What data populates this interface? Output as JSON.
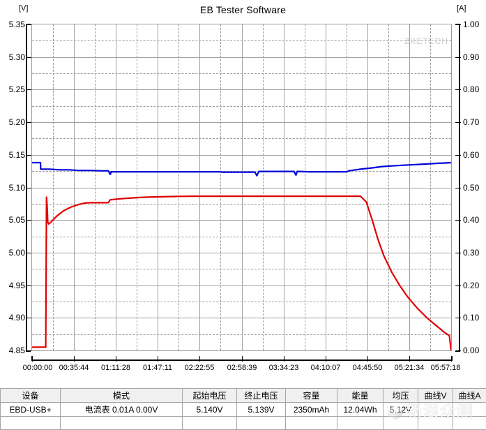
{
  "header": {
    "title": "EB Tester Software",
    "unit_left": "[V]",
    "unit_right": "[A]"
  },
  "plot": {
    "watermark": "ZKETECH"
  },
  "watermark_overlay": {
    "text": "新浪众测",
    "logo": "sina-cube-logo"
  },
  "chart_data": {
    "type": "line",
    "title": "EB Tester Software",
    "xlabel": "",
    "ylabel": "[V]",
    "ylabel_right": "[A]",
    "grid": true,
    "legend_position": "table-swatches",
    "x_ticklabels": [
      "00:00:00",
      "00:35:44",
      "01:11:28",
      "01:47:11",
      "02:22:55",
      "02:58:39",
      "03:34:23",
      "04:10:07",
      "04:45:50",
      "05:21:34",
      "05:57:18"
    ],
    "x_tick_seconds": [
      0,
      2144,
      4288,
      6431,
      8575,
      10719,
      12863,
      15007,
      17150,
      19294,
      21438
    ],
    "xlim_seconds": [
      0,
      21438
    ],
    "ylim_left": [
      4.85,
      5.35
    ],
    "y_ticklabels_left": [
      "5.35",
      "5.30",
      "5.25",
      "5.20",
      "5.15",
      "5.10",
      "5.05",
      "5.00",
      "4.95",
      "4.90",
      "4.85"
    ],
    "y_tickvalues_left": [
      5.35,
      5.3,
      5.25,
      5.2,
      5.15,
      5.1,
      5.05,
      5.0,
      4.95,
      4.9,
      4.85
    ],
    "ylim_right": [
      0.0,
      1.0
    ],
    "y_ticklabels_right": [
      "1.00",
      "0.90",
      "0.80",
      "0.70",
      "0.60",
      "0.50",
      "0.40",
      "0.30",
      "0.20",
      "0.10",
      "0.00"
    ],
    "y_tickvalues_right": [
      1.0,
      0.9,
      0.8,
      0.7,
      0.6,
      0.5,
      0.4,
      0.3,
      0.2,
      0.1,
      0.0
    ],
    "series": [
      {
        "name": "曲线V",
        "axis": "left",
        "unit": "V",
        "color": "#0000d8",
        "x": [
          0,
          430,
          440,
          900,
          1400,
          1900,
          2400,
          3000,
          3500,
          3900,
          4000,
          4050,
          4100,
          4600,
          5200,
          6000,
          7000,
          8000,
          9000,
          9600,
          9700,
          10400,
          11000,
          11400,
          11500,
          11600,
          12300,
          13400,
          13500,
          13560,
          13620,
          14200,
          15000,
          15600,
          16100,
          16200,
          16800,
          17400,
          17900,
          18400,
          19000,
          19600,
          20200,
          20800,
          21438
        ],
        "y": [
          5.138,
          5.138,
          5.128,
          5.128,
          5.127,
          5.127,
          5.126,
          5.126,
          5.1255,
          5.1255,
          5.12,
          5.124,
          5.124,
          5.124,
          5.124,
          5.124,
          5.124,
          5.124,
          5.124,
          5.124,
          5.1235,
          5.1235,
          5.1235,
          5.1235,
          5.118,
          5.1245,
          5.1245,
          5.1245,
          5.119,
          5.1245,
          5.1245,
          5.124,
          5.124,
          5.124,
          5.124,
          5.1255,
          5.128,
          5.13,
          5.132,
          5.133,
          5.134,
          5.135,
          5.136,
          5.137,
          5.138
        ]
      },
      {
        "name": "曲线A",
        "axis": "right",
        "unit": "A",
        "color": "#e00000",
        "x": [
          0,
          700,
          740,
          780,
          800,
          850,
          950,
          1100,
          1300,
          1600,
          2000,
          2400,
          2700,
          3000,
          3300,
          3600,
          3900,
          4000,
          4050,
          4300,
          4700,
          5200,
          5800,
          6400,
          7000,
          7600,
          8200,
          9000,
          10000,
          11000,
          12000,
          13000,
          14000,
          15000,
          16000,
          16800,
          17100,
          17400,
          17700,
          18000,
          18400,
          18800,
          19200,
          19700,
          20200,
          20700,
          21100,
          21350,
          21438
        ],
        "y": [
          0.01,
          0.01,
          0.47,
          0.43,
          0.395,
          0.388,
          0.392,
          0.402,
          0.414,
          0.428,
          0.44,
          0.448,
          0.452,
          0.453,
          0.453,
          0.453,
          0.453,
          0.462,
          0.462,
          0.464,
          0.466,
          0.468,
          0.47,
          0.471,
          0.472,
          0.4725,
          0.473,
          0.473,
          0.473,
          0.473,
          0.473,
          0.473,
          0.473,
          0.473,
          0.473,
          0.473,
          0.455,
          0.4,
          0.34,
          0.29,
          0.24,
          0.2,
          0.165,
          0.13,
          0.1,
          0.075,
          0.055,
          0.045,
          0.0
        ]
      }
    ]
  },
  "table": {
    "headers": [
      "设备",
      "模式",
      "起始电压",
      "终止电压",
      "容量",
      "能量",
      "均压",
      "曲线V",
      "曲线A"
    ],
    "rows": [
      [
        "EBD-USB+",
        "电流表  0.01A  0.00V",
        "5.140V",
        "5.139V",
        "2350mAh",
        "12.04Wh",
        "5.12V",
        "",
        ""
      ],
      [
        "",
        "",
        "",
        "",
        "",
        "",
        "",
        "",
        ""
      ]
    ],
    "curve_v_color": "#0000d8",
    "curve_a_color": "#e00000"
  }
}
